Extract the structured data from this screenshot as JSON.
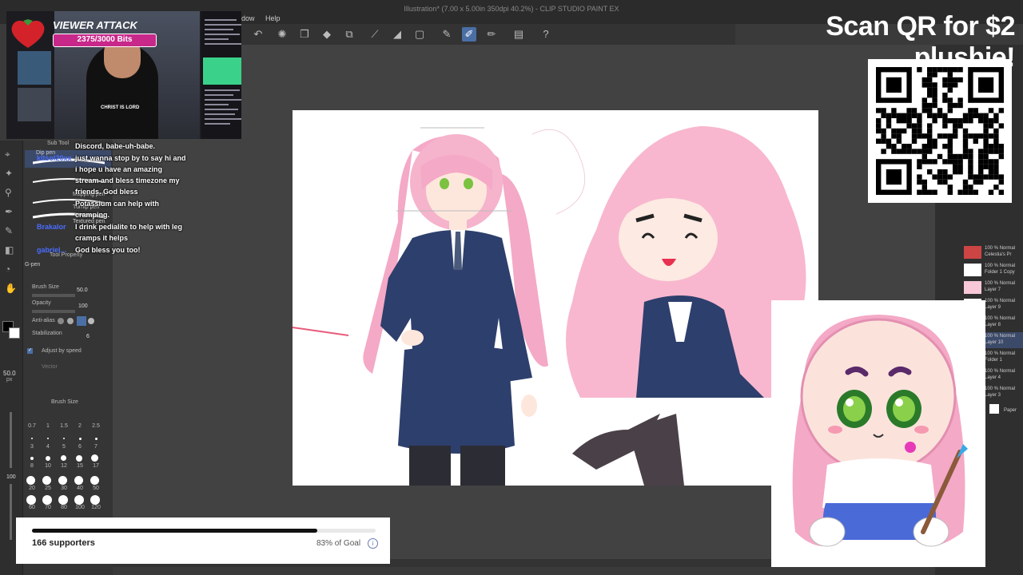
{
  "app": {
    "window_title": "Illustration* (7.00 x 5.00in 350dpi 40.2%) - CLIP STUDIO PAINT EX",
    "menu_window_partial": "dow",
    "menu_help": "Help"
  },
  "stream_overlay": {
    "viewer_attack": {
      "title": "VIEWER ATTACK",
      "progress_text": "2375/3000 Bits",
      "progress_fraction": 0.79
    },
    "webcam_shirt_text": "CHRIST IS LORD",
    "qr_heading": "Scan QR for $2 plushie!",
    "goal": {
      "supporters_text": "166 supporters",
      "percent_text": "83% of Goal",
      "progress_fraction": 0.83,
      "info_icon": "i"
    }
  },
  "chat": [
    {
      "name": "",
      "message": "Discord, babe-uh-babe."
    },
    {
      "name": "kitsol20xx",
      "message": "just wanna stop by to say hi and"
    },
    {
      "name": "",
      "message": "i hope u have an amazing"
    },
    {
      "name": "",
      "message": "stream and bless timezone my"
    },
    {
      "name": "",
      "message": "friends. God bless"
    },
    {
      "name": "",
      "message": "Potassium can help with"
    },
    {
      "name": "",
      "message": "cramping."
    },
    {
      "name": "Brakalor",
      "message": "I drink pedialite to help with leg"
    },
    {
      "name": "",
      "message": "cramps it helps"
    },
    {
      "name": "gabriel...",
      "message": "God bless you too!"
    }
  ],
  "sub_tool": {
    "header": "Sub Tool",
    "tools": [
      "Dip pen",
      "Mapping pen",
      "Turnip pen",
      "Textured pen",
      "G-pen"
    ]
  },
  "tool_property": {
    "header": "Tool Property",
    "brush_size_label": "Brush Size",
    "brush_size_value": "50.0",
    "opacity_label": "Opacity",
    "opacity_value": "100",
    "antialias_label": "Anti-alias",
    "stabilization_label": "Stabilization",
    "stabilization_value": "6",
    "adjust_speed_label": "Adjust by speed",
    "vector_label": "Vector"
  },
  "brush_size_panel": {
    "header": "Brush Size",
    "row1": [
      "0.7",
      "1",
      "1.5",
      "2",
      "2.5"
    ],
    "row2": [
      "3",
      "4",
      "5",
      "6",
      "7"
    ],
    "row3": [
      "8",
      "10",
      "12",
      "15",
      "17"
    ],
    "row4": [
      "20",
      "25",
      "30",
      "40",
      "50"
    ],
    "row5": [
      "60",
      "70",
      "80",
      "100",
      "120"
    ]
  },
  "left_strip": {
    "size_readout": "50.0",
    "size_unit": "px",
    "opacity_readout": "100"
  },
  "layers": [
    {
      "opacity": "100 %",
      "blend": "Normal",
      "name": "Celestia's Pr"
    },
    {
      "opacity": "100 %",
      "blend": "Normal",
      "name": "Folder 1 Copy"
    },
    {
      "opacity": "100 %",
      "blend": "Normal",
      "name": "Layer 7"
    },
    {
      "opacity": "100 %",
      "blend": "Normal",
      "name": "Layer 9"
    },
    {
      "opacity": "100 %",
      "blend": "Normal",
      "name": "Layer 8"
    },
    {
      "opacity": "100 %",
      "blend": "Normal",
      "name": "Layer 10"
    },
    {
      "opacity": "100 %",
      "blend": "Normal",
      "name": "Folder 1"
    },
    {
      "opacity": "100 %",
      "blend": "Normal",
      "name": "Layer 4"
    },
    {
      "opacity": "100 %",
      "blend": "Normal",
      "name": "Layer 3"
    },
    {
      "opacity": "",
      "blend": "",
      "name": "Paper"
    }
  ],
  "colors": {
    "bits_bar": "#c8288a",
    "chat_name": "#4a6cff",
    "active_tool": "#4a6fa5",
    "hair_pink": "#f4a9c6",
    "suit_navy": "#2d3f6c"
  }
}
